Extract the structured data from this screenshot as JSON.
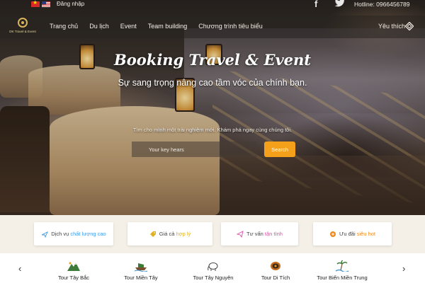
{
  "topbar": {
    "login_label": "Đăng nhập",
    "flags": [
      "vietnam-flag-icon",
      "us-flag-icon"
    ],
    "social": [
      "facebook-icon",
      "twitter-icon"
    ],
    "hotline": "Hotline: 0966456789"
  },
  "nav": {
    "logo_text": "DK Travel & Event",
    "items": [
      "Trang chủ",
      "Du lịch",
      "Event",
      "Team building",
      "Chương trình tiêu biểu"
    ],
    "favorites_label": "Yêu thích"
  },
  "hero": {
    "title": "Booking Travel & Event",
    "subtitle": "Sự sang trọng nâng cao tầm vóc của chính bạn.",
    "description": "Tìm cho mình một trải nghiệm mới. Khám phá ngay cùng chúng tôi.",
    "search_placeholder": "Your key hears",
    "search_button": "Search"
  },
  "features": [
    {
      "prefix": "Dịch vụ ",
      "highlight": "chất lượng cao",
      "icon": "plane-icon",
      "color": "#3d9be9"
    },
    {
      "prefix": "Giá cả ",
      "highlight": "hợp lý",
      "icon": "price-tag-icon",
      "color": "#e0b020"
    },
    {
      "prefix": "Tư vấn ",
      "highlight": "tận tình",
      "icon": "paper-plane-icon",
      "color": "#e24aa8"
    },
    {
      "prefix": "Ưu đãi ",
      "highlight": "siêu hot",
      "icon": "gift-icon",
      "color": "#f08a1c"
    }
  ],
  "tours": [
    {
      "label": "Tour Tây Bắc",
      "icon": "mountain-icon"
    },
    {
      "label": "Tour Miền Tây",
      "icon": "boat-icon"
    },
    {
      "label": "Tour Tây Nguyên",
      "icon": "elephant-icon"
    },
    {
      "label": "Tour Di Tích",
      "icon": "drum-icon"
    },
    {
      "label": "Tour Biển Miền Trung",
      "icon": "beach-icon"
    }
  ],
  "colors": {
    "accent": "#f5a01a",
    "nav_bg": "#28241f",
    "features_bg": "#f4f0e8"
  }
}
